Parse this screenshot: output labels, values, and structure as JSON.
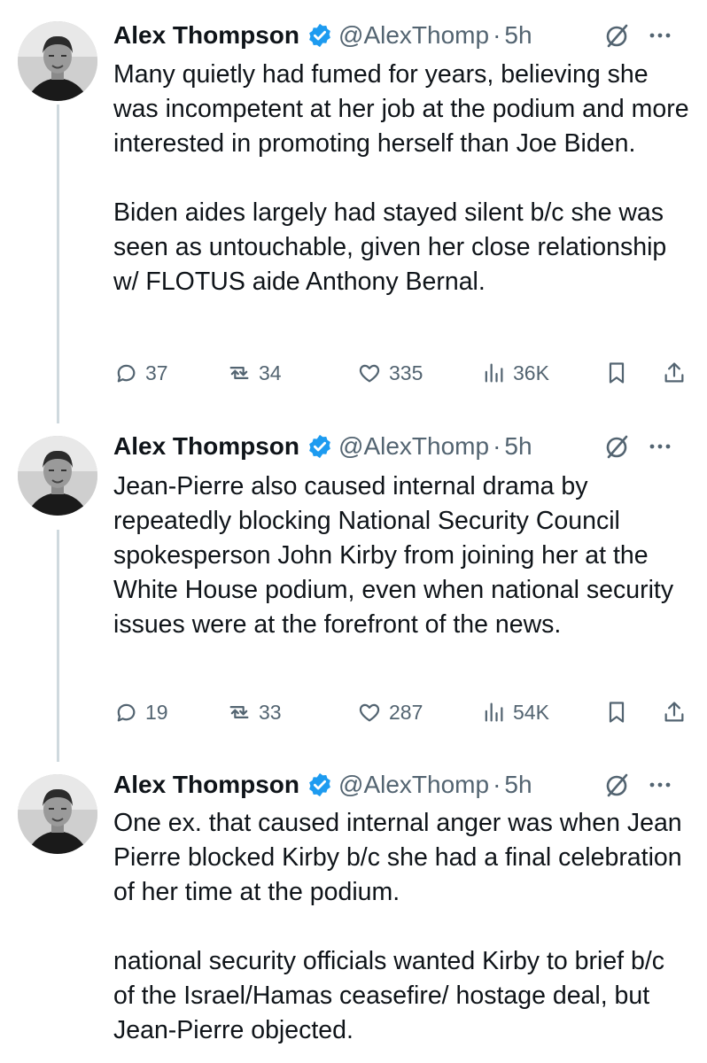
{
  "tweets": [
    {
      "author": {
        "name": "Alex Thompson",
        "handle": "@AlexThomp",
        "separator": "·",
        "time": "5h"
      },
      "paragraphs": [
        "Many quietly had fumed for years, believing she was incompetent at her job at the podium and more interested in promoting herself than Joe Biden.",
        "Biden aides largely had stayed silent b/c she was seen as untouchable, given her close relationship w/ FLOTUS aide Anthony Bernal."
      ],
      "stats": {
        "replies": "37",
        "reposts": "34",
        "likes": "335",
        "views": "36K"
      }
    },
    {
      "author": {
        "name": "Alex Thompson",
        "handle": "@AlexThomp",
        "separator": "·",
        "time": "5h"
      },
      "paragraphs": [
        "Jean-Pierre also caused internal drama by repeatedly blocking National Security Council spokesperson John Kirby from joining her at the White House podium, even when national security issues were at the forefront of the news."
      ],
      "stats": {
        "replies": "19",
        "reposts": "33",
        "likes": "287",
        "views": "54K"
      }
    },
    {
      "author": {
        "name": "Alex Thompson",
        "handle": "@AlexThomp",
        "separator": "·",
        "time": "5h"
      },
      "paragraphs": [
        "One ex. that caused internal anger was when Jean Pierre blocked Kirby b/c she had a final celebration of her time at the podium.",
        "national security officials wanted Kirby to brief b/c of the Israel/Hamas ceasefire/ hostage deal, but Jean-Pierre objected."
      ]
    }
  ],
  "icons": {
    "verified": "verified-badge-icon",
    "grok": "grok-icon",
    "more": "more-icon",
    "reply": "reply-icon",
    "repost": "repost-icon",
    "like": "like-icon",
    "views": "views-icon",
    "bookmark": "bookmark-icon",
    "share": "share-icon"
  },
  "colors": {
    "text": "#0f1419",
    "secondary": "#536471",
    "verified": "#1d9bf0",
    "thread_line": "#cfd9de"
  }
}
